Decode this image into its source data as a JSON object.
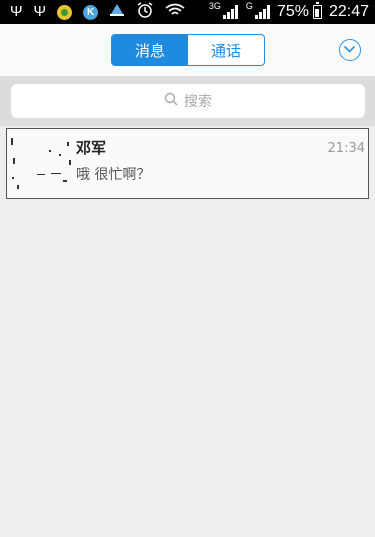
{
  "status_bar": {
    "net_label_1": "3G",
    "net_label_2": "G",
    "battery": "75%",
    "time": "22:47",
    "icons": [
      "usb-icon",
      "usb-icon",
      "app-icon",
      "k-app-icon",
      "boat-icon",
      "alarm-icon",
      "wifi-icon",
      "signal-icon",
      "signal-icon",
      "battery-icon"
    ]
  },
  "header": {
    "tabs": [
      {
        "label": "消息",
        "active": true
      },
      {
        "label": "通话",
        "active": false
      }
    ],
    "accent_color": "#1e8be0"
  },
  "search": {
    "placeholder": "搜索"
  },
  "conversations": [
    {
      "name": "邓军",
      "time": "21:34",
      "preview": "哦 很忙啊？"
    }
  ]
}
